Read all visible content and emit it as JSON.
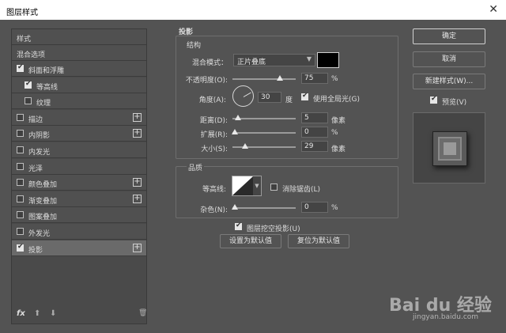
{
  "dialog": {
    "title": "图层样式",
    "close": "✕"
  },
  "sidebar": {
    "header": "样式",
    "blend_options": "混合选项",
    "items": [
      {
        "label": "斜面和浮雕",
        "checked": true,
        "plus": false
      },
      {
        "label": "等高线",
        "checked": true,
        "plus": false
      },
      {
        "label": "纹理",
        "checked": false,
        "plus": false
      },
      {
        "label": "描边",
        "checked": false,
        "plus": true
      },
      {
        "label": "内阴影",
        "checked": false,
        "plus": true
      },
      {
        "label": "内发光",
        "checked": false,
        "plus": false
      },
      {
        "label": "光泽",
        "checked": false,
        "plus": false
      },
      {
        "label": "颜色叠加",
        "checked": false,
        "plus": true
      },
      {
        "label": "渐变叠加",
        "checked": false,
        "plus": true
      },
      {
        "label": "图案叠加",
        "checked": false,
        "plus": false
      },
      {
        "label": "外发光",
        "checked": false,
        "plus": false
      },
      {
        "label": "投影",
        "checked": true,
        "plus": true
      }
    ],
    "fx": "fx",
    "up": "⬆",
    "down": "⬇",
    "trash": "🗑"
  },
  "shadow": {
    "title": "投影",
    "structure": {
      "title": "结构",
      "blend_mode_label": "混合模式：",
      "blend_mode_value": "正片叠底",
      "blend_color": "#000000",
      "opacity_label": "不透明度(O):",
      "opacity_value": "75",
      "opacity_unit": "%",
      "opacity_fraction": 0.75,
      "angle_label": "角度(A):",
      "angle_value": "30",
      "angle_unit": "度",
      "global_light_label": "使用全局光(G)",
      "global_light_checked": true,
      "distance_label": "距离(D):",
      "distance_value": "5",
      "distance_unit": "像素",
      "spread_label": "扩展(R):",
      "spread_value": "0",
      "spread_unit": "%",
      "size_label": "大小(S):",
      "size_value": "29",
      "size_unit": "像素"
    },
    "quality": {
      "title": "品质",
      "contour_label": "等高线:",
      "antialias_label": "消除锯齿(L)",
      "antialias_checked": false,
      "noise_label": "杂色(N):",
      "noise_value": "0",
      "noise_unit": "%"
    },
    "knockout_label": "图层挖空投影(U)",
    "knockout_checked": true,
    "set_default": "设置为默认值",
    "reset_default": "复位为默认值"
  },
  "buttons": {
    "ok": "确定",
    "cancel": "取消",
    "new_style": "新建样式(W)...",
    "preview_label": "预览(V)",
    "preview_checked": true
  },
  "watermark": {
    "brand": "Bai du 经验",
    "url": "jingyan.baidu.com"
  }
}
